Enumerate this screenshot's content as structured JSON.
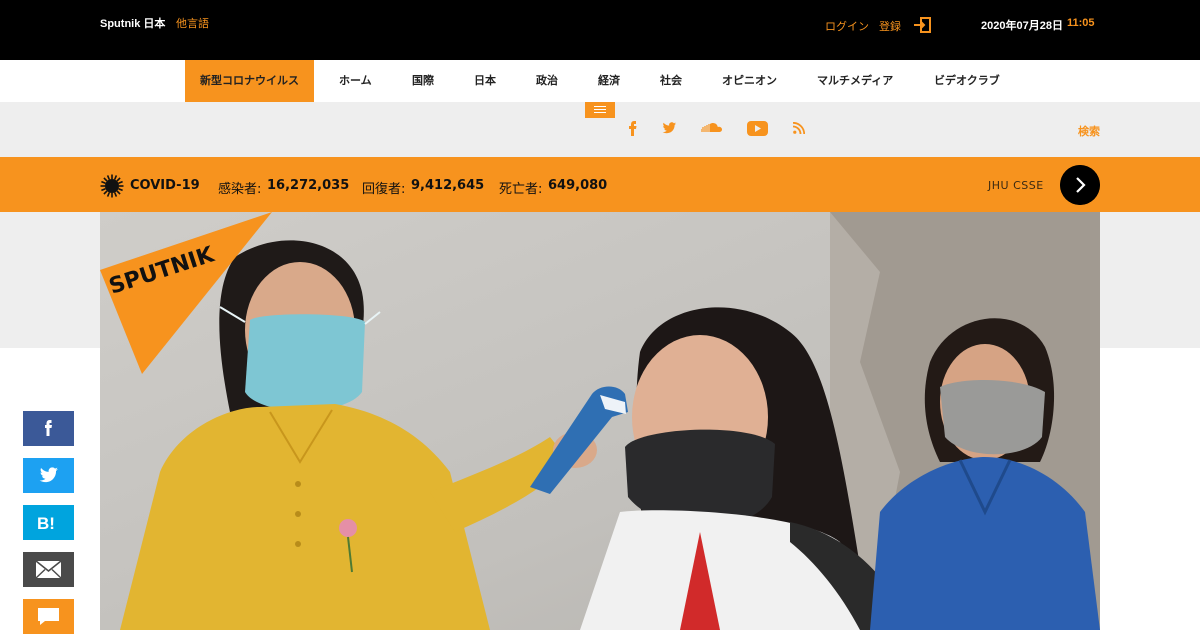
{
  "header": {
    "brand": "Sputnik 日本",
    "other_languages": "他言語",
    "login": "ログイン",
    "register": "登録",
    "date": "2020年07月28日",
    "time": "11:05"
  },
  "nav": {
    "items": [
      "新型コロナウイルス",
      "ホーム",
      "国際",
      "日本",
      "政治",
      "経済",
      "社会",
      "オピニオン",
      "マルチメディア",
      "ビデオクラブ"
    ]
  },
  "subbar": {
    "social_icons": [
      "facebook-icon",
      "twitter-icon",
      "soundcloud-icon",
      "youtube-icon",
      "rss-icon"
    ],
    "search": "検索"
  },
  "covid": {
    "title": "COVID-19",
    "infected_label": "感染者:",
    "infected_value": "16,272,035",
    "recovered_label": "回復者:",
    "recovered_value": "9,412,645",
    "deaths_label": "死亡者:",
    "deaths_value": "649,080",
    "source": "JHU CSSE"
  },
  "photo": {
    "logo_text": "SPUTNIK"
  },
  "share": {
    "items": [
      "facebook",
      "twitter",
      "hatena",
      "email",
      "comment"
    ],
    "hatena_label": "B!"
  },
  "colors": {
    "accent": "#f7931e",
    "topbar": "#000000",
    "subbar": "#eeeeee"
  }
}
